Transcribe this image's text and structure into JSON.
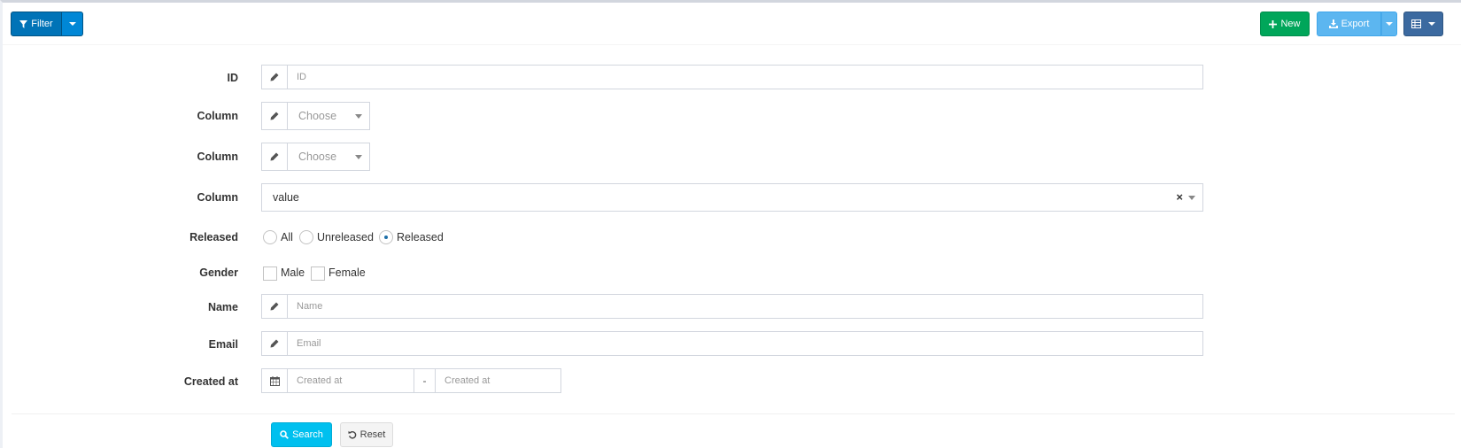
{
  "toolbar": {
    "filter_label": "Filter",
    "new_label": "New",
    "export_label": "Export"
  },
  "form": {
    "id": {
      "label": "ID",
      "placeholder": "ID"
    },
    "column1": {
      "label": "Column",
      "value": "Choose"
    },
    "column2": {
      "label": "Column",
      "value": "Choose"
    },
    "column3": {
      "label": "Column",
      "value": "value",
      "clear": "×"
    },
    "released": {
      "label": "Released",
      "options": [
        "All",
        "Unreleased",
        "Released"
      ],
      "selected": "Released"
    },
    "gender": {
      "label": "Gender",
      "options": [
        "Male",
        "Female"
      ]
    },
    "name": {
      "label": "Name",
      "placeholder": "Name"
    },
    "email": {
      "label": "Email",
      "placeholder": "Email"
    },
    "created_at": {
      "label": "Created at",
      "start_placeholder": "Created at",
      "separator": "-",
      "end_placeholder": "Created at"
    }
  },
  "actions": {
    "search_label": "Search",
    "reset_label": "Reset"
  },
  "colors": {
    "primary": "#0073b7",
    "success": "#00a65a",
    "info": "#00c0ef",
    "export": "#5cb6f0",
    "columns": "#3c6aa0"
  },
  "icons": {
    "filter": "filter-icon",
    "new": "plus-icon",
    "export": "download-icon",
    "columns": "table-icon",
    "edit": "pencil-icon",
    "calendar": "calendar-icon",
    "search": "search-icon",
    "reset": "undo-icon"
  }
}
